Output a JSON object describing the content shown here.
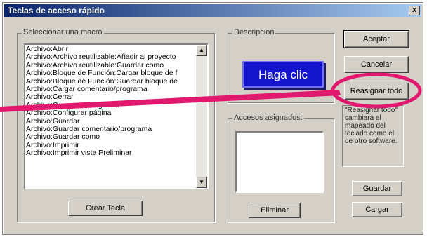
{
  "window": {
    "title": "Teclas de acceso rápido",
    "close_label": "x"
  },
  "macro_group": {
    "label": "Seleccionar una macro",
    "items": [
      "Archivo:Abrir",
      "Archivo:Archivo reutilizable:Añadir al proyecto",
      "Archivo:Archivo reutilizable:Guardar como",
      "Archivo:Bloque de Función:Cargar bloque de f",
      "Archivo:Bloque de Función:Guardar bloque de",
      "Archivo:Cargar comentario/programa",
      "Archivo:Cerrar",
      "Archivo:Comparar programa",
      "Archivo:Configurar página",
      "Archivo:Guardar",
      "Archivo:Guardar comentario/programa",
      "Archivo:Guardar como",
      "Archivo:Imprimir",
      "Archivo:Imprimir vista Preliminar"
    ],
    "create_key_button": "Crear Tecla"
  },
  "description_group": {
    "label": "Descripción"
  },
  "assigned_group": {
    "label": "Accesos asignados:",
    "delete_button": "Eliminar"
  },
  "buttons": {
    "accept": "Aceptar",
    "cancel": "Cancelar",
    "reassign_all": "Reasignar todo",
    "save": "Guardar",
    "load": "Cargar"
  },
  "tooltip_text": "\"Reasignar todo\" cambiará el mapeado del teclado como el de otro software.",
  "callout": {
    "text": "Haga clic"
  },
  "colors": {
    "dialog_face": "#d4d0c8",
    "title_gradient_start": "#0a246a",
    "title_gradient_end": "#a6caf0",
    "callout_fill": "#1414cc",
    "annotation_pink": "#e0196e"
  },
  "icons": [
    "close-icon",
    "scroll-up-arrow-icon",
    "scroll-down-arrow-icon"
  ]
}
